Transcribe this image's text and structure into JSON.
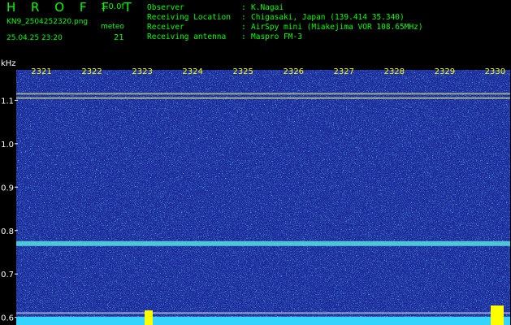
{
  "header": {
    "app_title": "H R O F F T",
    "version": "1.0.0f",
    "filename": "KN9_2504252320.png",
    "meteo_label": "meteo",
    "timestamp": "25.04.25 23:20",
    "meteo_count": "21",
    "info": [
      {
        "label": "Observer",
        "value": "K.Nagai"
      },
      {
        "label": "Receiving Location",
        "value": "Chigasaki, Japan (139.414 35.340)"
      },
      {
        "label": "Receiver",
        "value": "AirSpy mini (Miakejima VOR 108.65MHz)"
      },
      {
        "label": "Receiving antenna",
        "value": "Maspro FM-3"
      }
    ]
  },
  "colors": {
    "background": "#000000",
    "header_text": "#00ff00",
    "time_labels": "#ffff00",
    "axis_labels": "#ffffff",
    "spectrogram_bg": "#1a2a9a"
  },
  "chart_data": {
    "type": "heatmap",
    "ylabel": "kHz",
    "x_ticks": [
      "2321",
      "2322",
      "2323",
      "2324",
      "2325",
      "2326",
      "2327",
      "2328",
      "2329",
      "2330"
    ],
    "y_ticks": [
      "1.1",
      "1.0",
      "0.9",
      "0.8",
      "0.7",
      "0.6"
    ],
    "y_range": [
      0.59,
      1.17
    ],
    "x_range": [
      2320.5,
      2330.3
    ],
    "horizontal_lines_khz": [
      1.115,
      1.105,
      0.77,
      0.61,
      0.6
    ],
    "grid": false
  }
}
